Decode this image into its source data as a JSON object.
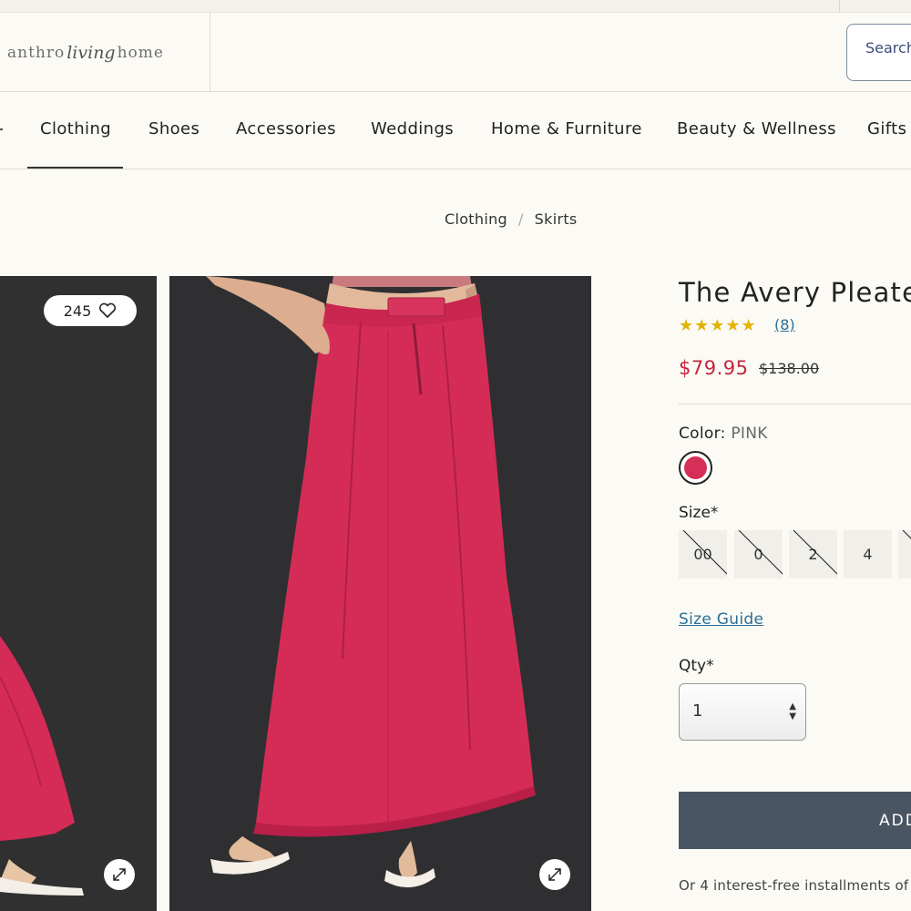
{
  "header": {
    "logo": {
      "part1": "anthro",
      "part2": "living",
      "part3": "home"
    },
    "search_label": "Search"
  },
  "nav": {
    "items": [
      "Clothing",
      "Shoes",
      "Accessories",
      "Weddings",
      "Home & Furniture",
      "Beauty & Wellness",
      "Gifts"
    ],
    "active": "Clothing"
  },
  "breadcrumb": [
    "Clothing",
    "Skirts"
  ],
  "gallery": {
    "like_count": "245"
  },
  "product": {
    "title": "The Avery Pleated",
    "rating": {
      "stars": "★★★★★",
      "count_label": "(8)",
      "value": 5
    },
    "sale_price": "$79.95",
    "original_price": "$138.00",
    "color_label": "Color:",
    "color_value": "PINK",
    "colors": {
      "swatch": "#d62f57"
    },
    "size_label": "Size*",
    "sizes": [
      {
        "label": "00",
        "available": false
      },
      {
        "label": "0",
        "available": false
      },
      {
        "label": "2",
        "available": false
      },
      {
        "label": "4",
        "available": true
      }
    ],
    "size_guide": "Size Guide",
    "qty_label": "Qty*",
    "qty_value": "1",
    "add_button": "ADD",
    "installments": "Or 4 interest-free installments of"
  }
}
